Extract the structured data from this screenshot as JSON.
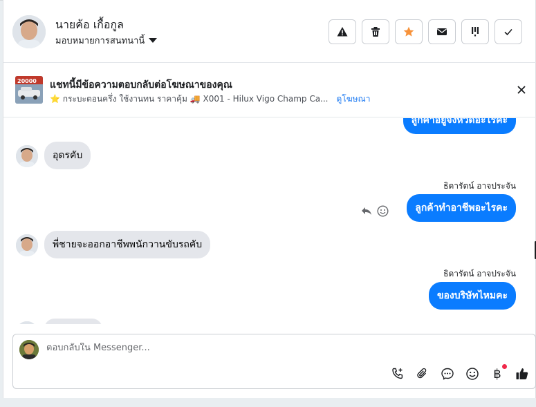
{
  "header": {
    "contact_name": "นายค้อ เกื้อกูล",
    "assign_label": "มอบหมายการสนทนานี้",
    "actions": [
      {
        "name": "report-button",
        "icon": "warning-icon"
      },
      {
        "name": "delete-button",
        "icon": "trash-icon"
      },
      {
        "name": "star-button",
        "icon": "star-icon"
      },
      {
        "name": "mark-unread-button",
        "icon": "envelope-icon"
      },
      {
        "name": "follow-up-button",
        "icon": "follow-up-icon"
      },
      {
        "name": "done-button",
        "icon": "check-icon"
      }
    ]
  },
  "ad": {
    "thumb_text": "20000",
    "title": "แชทนี้มีข้อความตอบกลับต่อโฆษณาของคุณ",
    "subtitle": "⭐ กระบะตอนครึ่ง ใช้งานทน ราคาคุ้ม 🚚 X001 - Hilux Vigo Champ Ca...",
    "link": "ดูโฆษณา"
  },
  "messages": [
    {
      "side": "out",
      "text": "ลูกค้าอยู่จังหวัดอะไรคะ"
    },
    {
      "side": "in",
      "text": "อุดรคับ"
    },
    {
      "side": "out",
      "sender": "ธิดารัตน์ อาจประจัน",
      "text": "ลูกค้าทำอาชีพอะไรคะ"
    },
    {
      "side": "in",
      "text": "พี่ชายจะออกอาชีพพนักวานขับรถคับ"
    },
    {
      "side": "out",
      "sender": "ธิดารัตน์ อาจประจัน",
      "text": "ของบริษัทไหมคะ"
    }
  ],
  "composer": {
    "placeholder": "ตอบกลับใน Messenger...",
    "baht_symbol": "฿"
  },
  "colors": {
    "outgoing_bubble": "#0a7cff",
    "incoming_bubble": "#e4e6eb",
    "star": "#f7923a",
    "notification_dot": "#f0284a"
  }
}
